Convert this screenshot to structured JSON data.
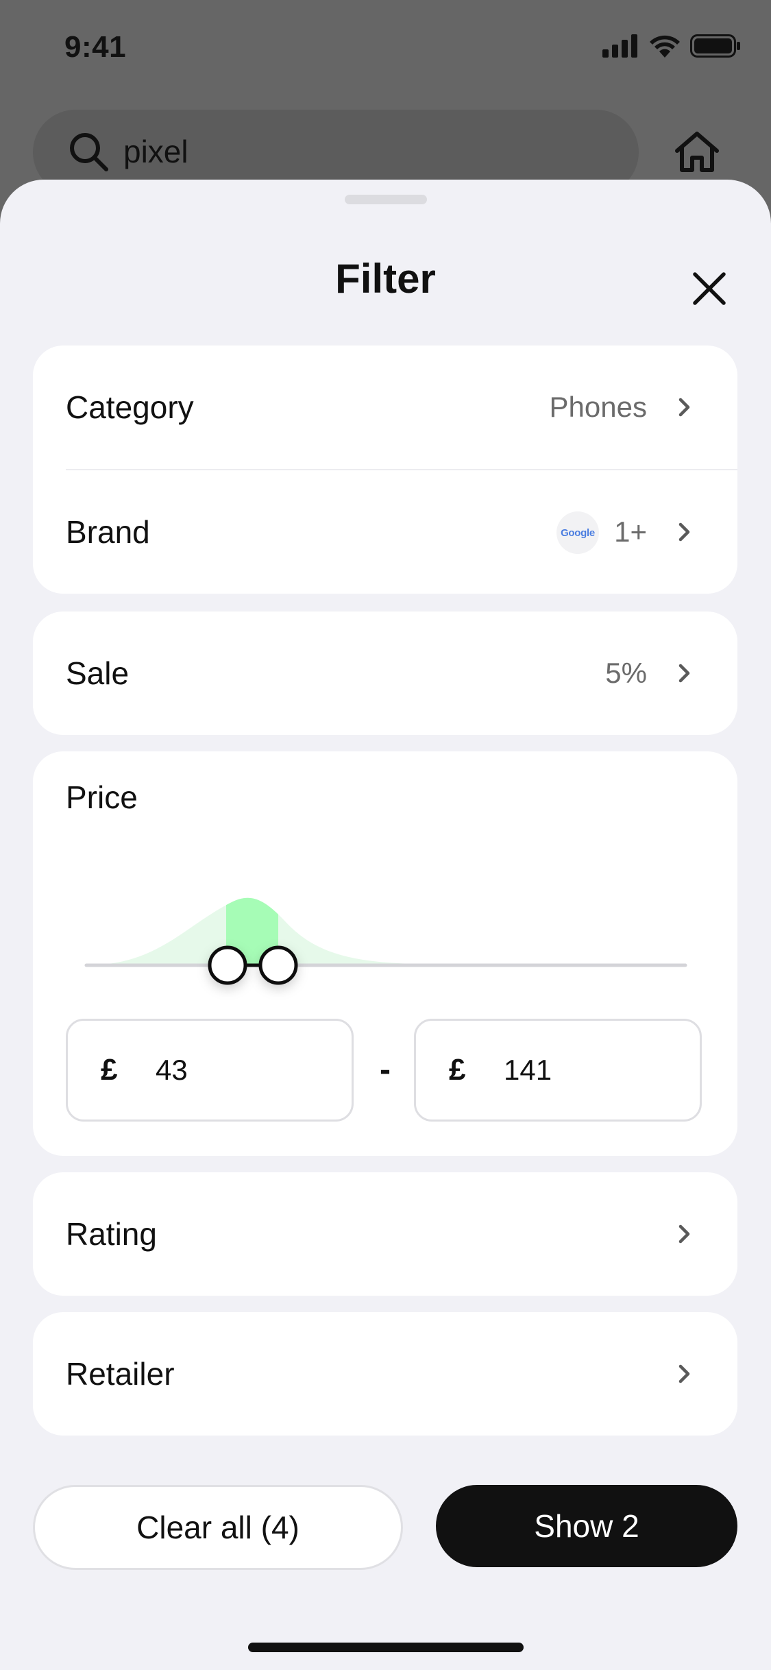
{
  "status_bar": {
    "time": "9:41",
    "icons": [
      "cellular-signal-icon",
      "wifi-icon",
      "battery-icon"
    ]
  },
  "search": {
    "query": "pixel",
    "icon": "search-icon"
  },
  "header": {
    "home_icon": "home-icon"
  },
  "sheet": {
    "title": "Filter",
    "close_icon": "close-icon"
  },
  "filters": {
    "category": {
      "label": "Category",
      "value": "Phones"
    },
    "brand": {
      "label": "Brand",
      "logo_text": "Google",
      "value": "1+"
    },
    "sale": {
      "label": "Sale",
      "value": "5%"
    },
    "price": {
      "label": "Price",
      "currency": "£",
      "min": "43",
      "max": "141",
      "separator": "-"
    },
    "rating": {
      "label": "Rating"
    },
    "retailer": {
      "label": "Retailer"
    }
  },
  "actions": {
    "clear_all": "Clear all (4)",
    "show": "Show 2"
  },
  "colors": {
    "sheet_background": "#f1f1f6",
    "card_background": "#ffffff",
    "primary_button": "#111111",
    "histogram_fill": "#e6f9ea",
    "histogram_selected": "#a6fcb6",
    "secondary_text": "#6b6b6b"
  }
}
